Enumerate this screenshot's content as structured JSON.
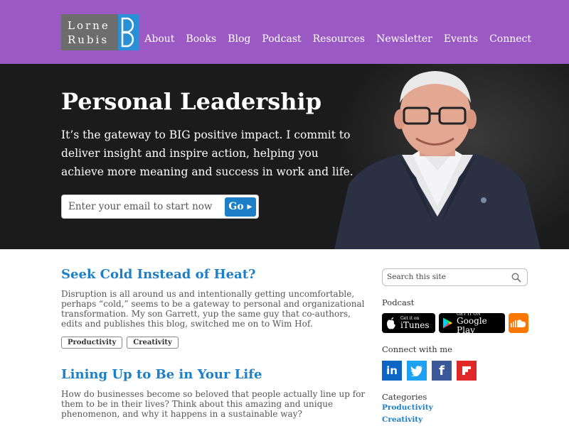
{
  "logo": {
    "line1": "Lorne",
    "line2": "Rubis"
  },
  "nav": [
    "About",
    "Books",
    "Blog",
    "Podcast",
    "Resources",
    "Newsletter",
    "Events",
    "Connect"
  ],
  "hero": {
    "title": "Personal Leadership",
    "text": "It’s the gateway to BIG positive impact. I commit to deliver insight and inspire action, helping you achieve more meaning and success in work and life.",
    "email_placeholder": "Enter your email to start now",
    "go_label": "Go ▸"
  },
  "posts": [
    {
      "title": "Seek Cold Instead of Heat?",
      "excerpt": "Disruption is all around us and intentionally getting uncomfortable, perhaps “cold,” seems to be a gateway to personal and organizational transformation. My son Garrett, yup the same guy that co-authors, edits and publishes this blog, switched me on to Wim Hof.",
      "tags": [
        "Productivity",
        "Creativity"
      ]
    },
    {
      "title": "Lining Up to Be in Your Life",
      "excerpt": "How do businesses become so beloved that people actually line up for them to be in their lives? Think about this amazing and unique phenomenon, and why it happens in a sustainable way?"
    }
  ],
  "sidebar": {
    "search_placeholder": "Search this site",
    "podcast_heading": "Podcast",
    "itunes": {
      "small": "Get it on",
      "big": "iTunes"
    },
    "google_play": {
      "small": "GET IT ON",
      "big": "Google Play"
    },
    "connect_heading": "Connect with me",
    "social_icons": [
      "linkedin-icon",
      "twitter-icon",
      "facebook-icon",
      "flipboard-icon"
    ],
    "categories_heading": "Categories",
    "categories": [
      "Productivity",
      "Creativity"
    ]
  },
  "colors": {
    "header": "#9b59c4",
    "accent": "#1d7fc7",
    "hero_bg": "#1b1b1b"
  }
}
